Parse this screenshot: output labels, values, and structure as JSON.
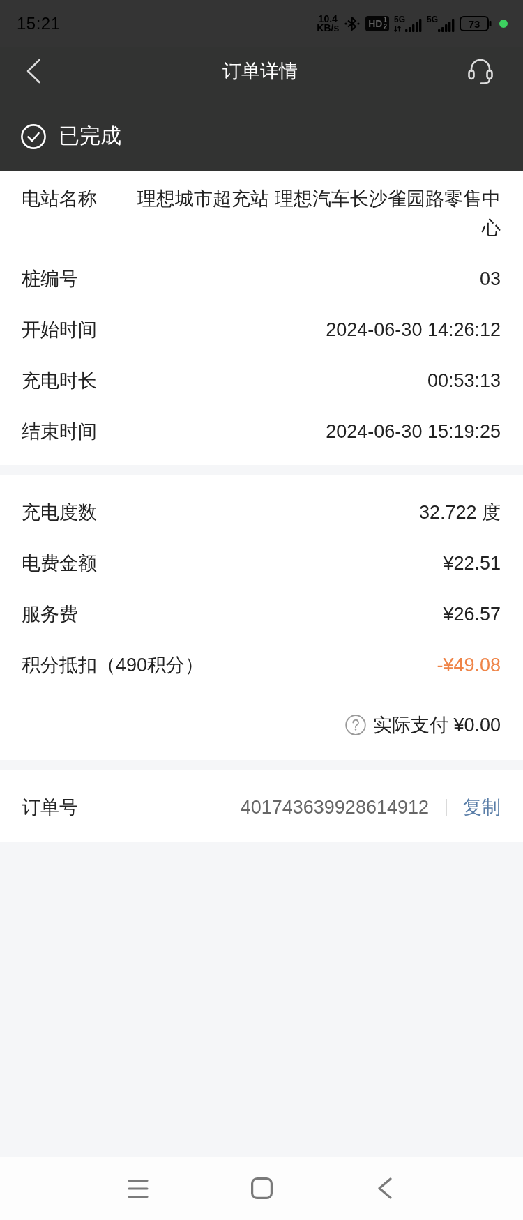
{
  "status_bar": {
    "time": "15:21",
    "network_speed": "10.4",
    "network_speed_unit": "KB/s",
    "hd_badge": {
      "label": "HD",
      "sim_slots": [
        "1",
        "2"
      ]
    },
    "signals": [
      {
        "network": "5G",
        "data_activity": true
      },
      {
        "network": "5G",
        "data_activity": false
      }
    ],
    "battery": "73"
  },
  "header": {
    "title": "订单详情"
  },
  "order_status": {
    "label": "已完成"
  },
  "sections": [
    {
      "rows": [
        {
          "kind": "text",
          "label": "电站名称",
          "value": "理想城市超充站 理想汽车长沙雀园路零售中心"
        },
        {
          "kind": "text",
          "label": "桩编号",
          "value": "03"
        },
        {
          "kind": "text",
          "label": "开始时间",
          "value": "2024-06-30 14:26:12"
        },
        {
          "kind": "text",
          "label": "充电时长",
          "value": "00:53:13"
        },
        {
          "kind": "text",
          "label": "结束时间",
          "value": "2024-06-30 15:19:25"
        }
      ]
    },
    {
      "rows": [
        {
          "kind": "text",
          "label": "充电度数",
          "value": "32.722 度"
        },
        {
          "kind": "text",
          "label": "电费金额",
          "value": "¥22.51"
        },
        {
          "kind": "text",
          "label": "服务费",
          "value": "¥26.57"
        },
        {
          "kind": "discount",
          "label": "积分抵扣（490积分）",
          "value": "-¥49.08"
        }
      ],
      "total": "实际支付 ¥0.00"
    },
    {
      "rows": [
        {
          "kind": "copy",
          "label": "订单号",
          "value": "401743639928614912",
          "action": "复制"
        }
      ]
    }
  ]
}
